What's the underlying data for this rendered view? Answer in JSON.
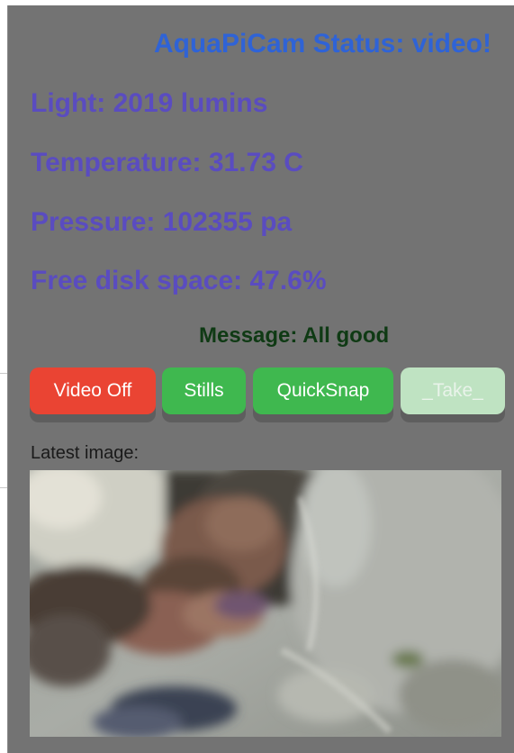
{
  "status": {
    "title": "AquaPiCam Status: video!"
  },
  "sensors": {
    "light": "Light: 2019 lumins",
    "temperature": "Temperature: 31.73 C",
    "pressure": "Pressure: 102355 pa",
    "disk": "Free disk space: 47.6%"
  },
  "message": "Message: All good",
  "buttons": {
    "video_off": "Video Off",
    "stills": "Stills",
    "quicksnap": "QuickSnap",
    "take": "_Take_"
  },
  "latest": {
    "label": "Latest image:"
  },
  "colors": {
    "panel_bg": "#737373",
    "title": "#2f63d6",
    "stat_text": "#5a4cc0",
    "message_text": "#0f3a14",
    "video_off_bg": "#ea4433",
    "action_bg": "#3fb84f",
    "take_bg_disabled": "#bfe3c2"
  }
}
